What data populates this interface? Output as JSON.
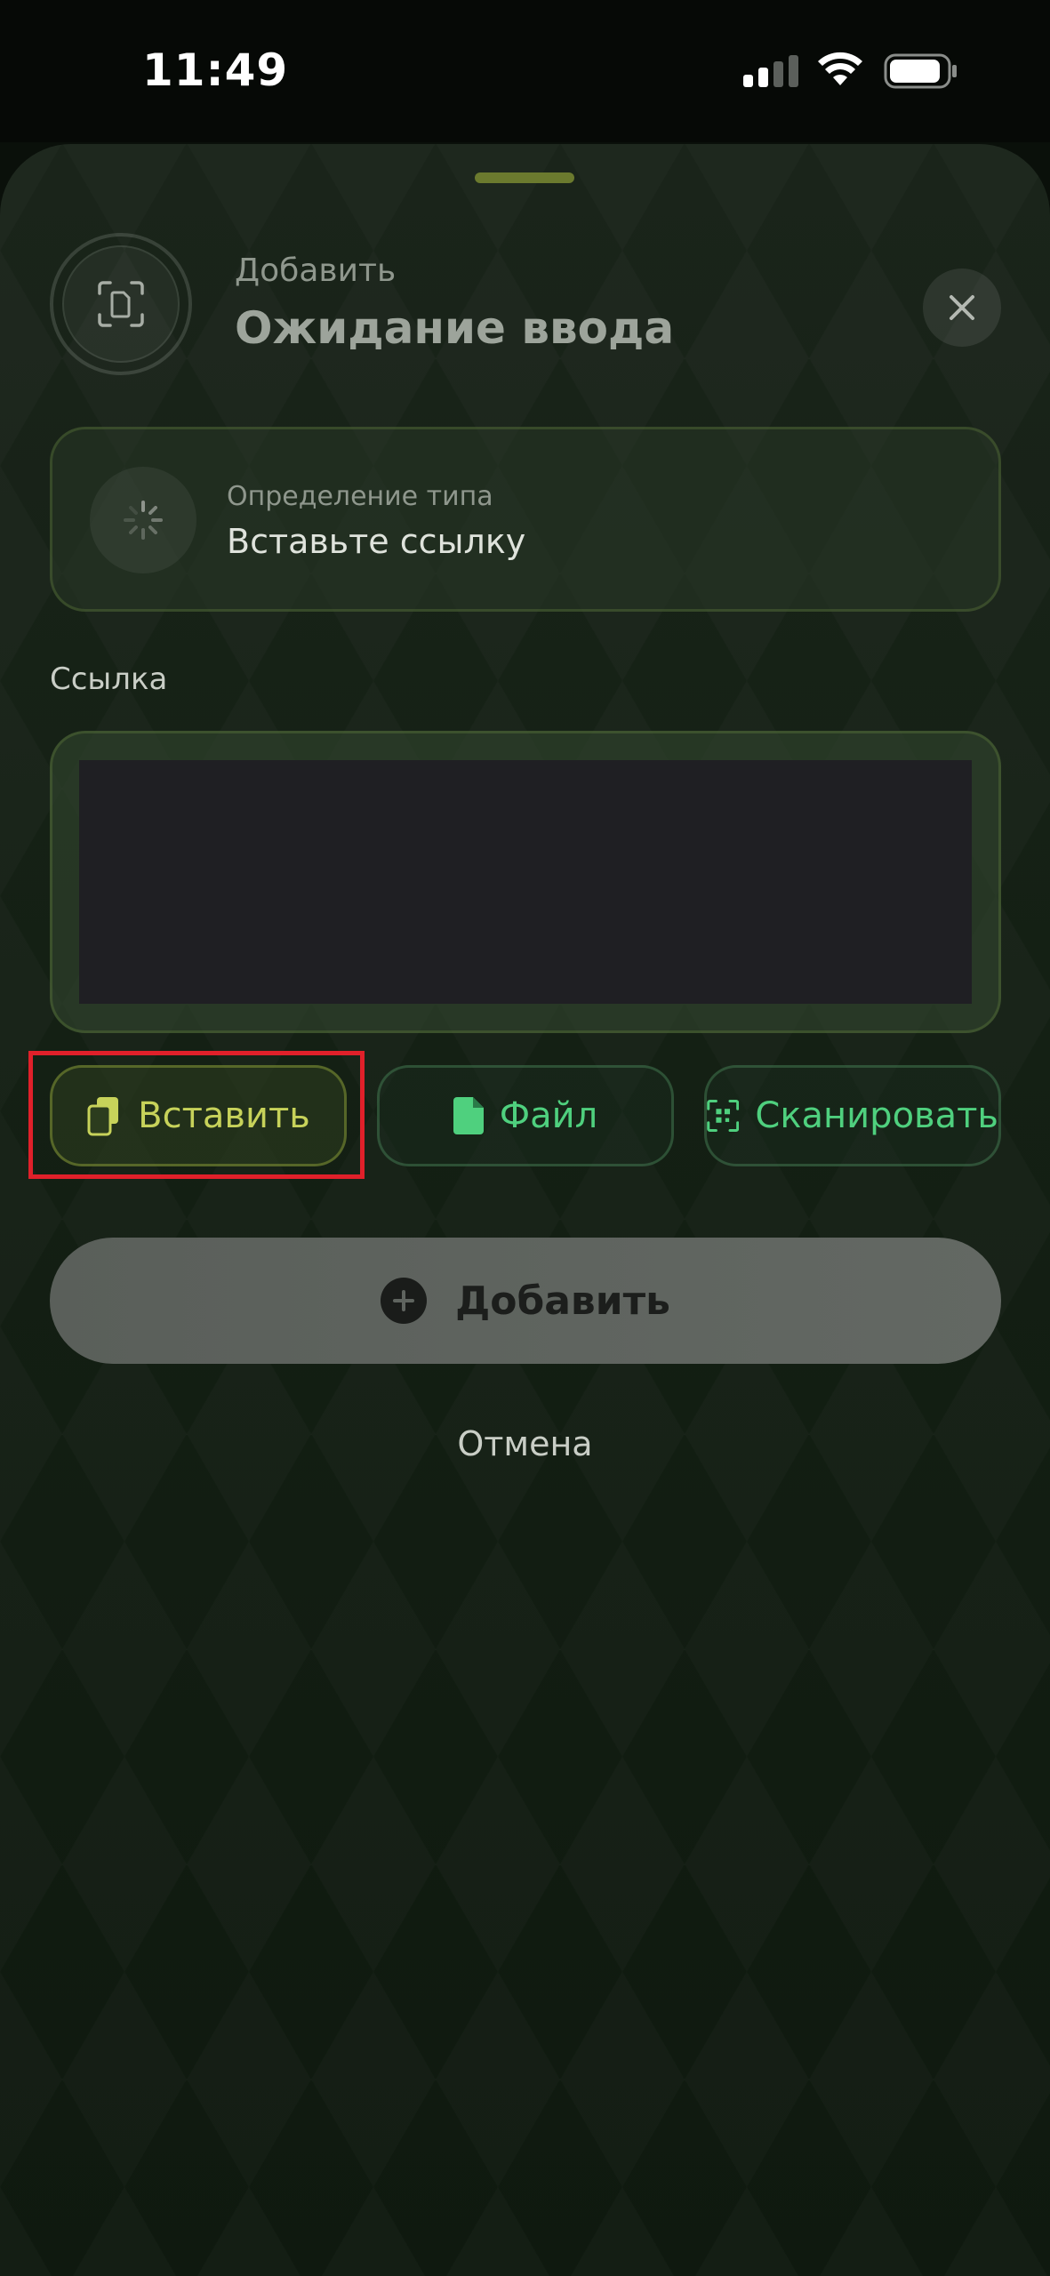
{
  "status_bar": {
    "time": "11:49",
    "icons": [
      "cellular-signal-icon",
      "wifi-icon",
      "battery-icon"
    ]
  },
  "sheet": {
    "header": {
      "subtitle": "Добавить",
      "title": "Ожидание ввода",
      "icon": "document-scan-icon",
      "close_icon": "close-icon"
    },
    "type_card": {
      "subtitle": "Определение типа",
      "title": "Вставьте ссылку",
      "icon": "loading-spinner-icon"
    },
    "link": {
      "label": "Ссылка",
      "value": "",
      "placeholder": ""
    },
    "actions": [
      {
        "label": "Вставить",
        "icon": "clipboard-paste-icon"
      },
      {
        "label": "Файл",
        "icon": "file-icon"
      },
      {
        "label": "Сканировать",
        "icon": "qr-scan-icon"
      }
    ],
    "add_button": {
      "label": "Добавить",
      "icon": "plus-circle-icon"
    },
    "cancel_label": "Отмена"
  },
  "colors": {
    "accent_paste": "#c7d25a",
    "accent_green": "#4fd07e",
    "highlight": "#e0202a"
  }
}
